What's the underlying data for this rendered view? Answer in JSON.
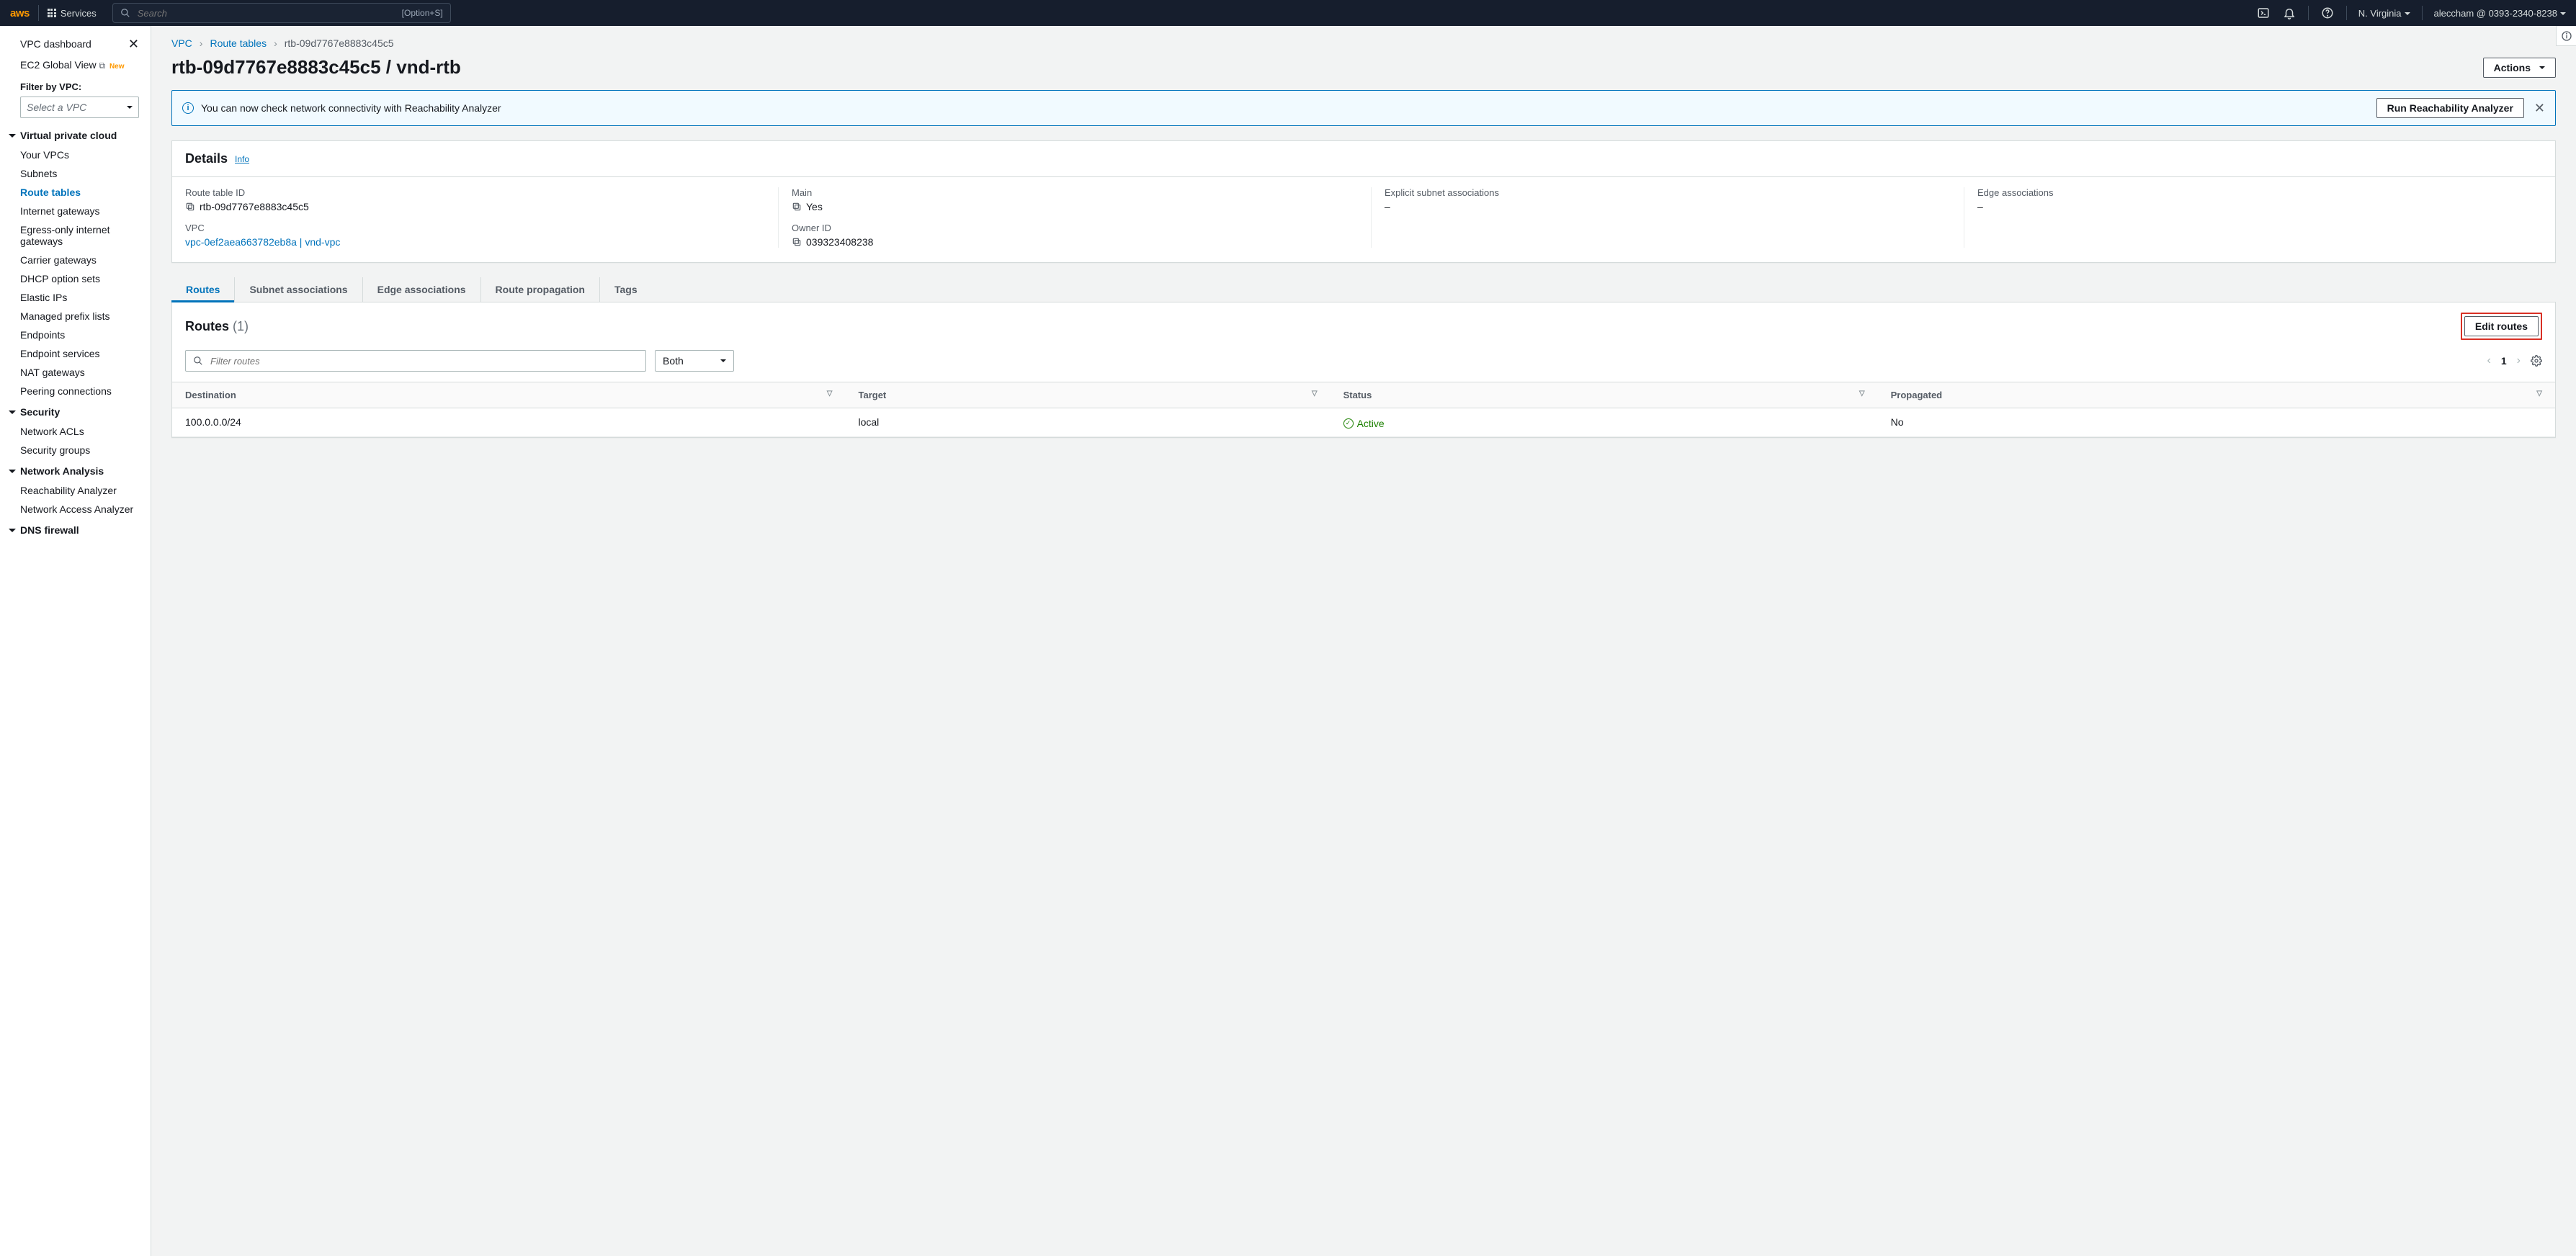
{
  "topnav": {
    "services_label": "Services",
    "search_placeholder": "Search",
    "search_hint": "[Option+S]",
    "region": "N. Virginia",
    "account": "aleccham @ 0393-2340-8238"
  },
  "sidebar": {
    "dashboard": "VPC dashboard",
    "ec2_global": "EC2 Global View",
    "new_badge": "New",
    "filter_label": "Filter by VPC:",
    "vpc_select_placeholder": "Select a VPC",
    "sections": {
      "vpc": {
        "title": "Virtual private cloud",
        "items": [
          "Your VPCs",
          "Subnets",
          "Route tables",
          "Internet gateways",
          "Egress-only internet gateways",
          "Carrier gateways",
          "DHCP option sets",
          "Elastic IPs",
          "Managed prefix lists",
          "Endpoints",
          "Endpoint services",
          "NAT gateways",
          "Peering connections"
        ]
      },
      "security": {
        "title": "Security",
        "items": [
          "Network ACLs",
          "Security groups"
        ]
      },
      "analysis": {
        "title": "Network Analysis",
        "items": [
          "Reachability Analyzer",
          "Network Access Analyzer"
        ]
      },
      "dns": {
        "title": "DNS firewall"
      }
    }
  },
  "breadcrumbs": {
    "vpc": "VPC",
    "route_tables": "Route tables",
    "current": "rtb-09d7767e8883c45c5"
  },
  "title": "rtb-09d7767e8883c45c5 / vnd-rtb",
  "actions_label": "Actions",
  "banner": {
    "text": "You can now check network connectivity with Reachability Analyzer",
    "button": "Run Reachability Analyzer"
  },
  "details": {
    "heading": "Details",
    "info_link": "Info",
    "fields": {
      "route_table_id": {
        "label": "Route table ID",
        "value": "rtb-09d7767e8883c45c5"
      },
      "main": {
        "label": "Main",
        "value": "Yes"
      },
      "explicit_assoc": {
        "label": "Explicit subnet associations",
        "value": "–"
      },
      "edge_assoc": {
        "label": "Edge associations",
        "value": "–"
      },
      "vpc": {
        "label": "VPC",
        "value": "vpc-0ef2aea663782eb8a | vnd-vpc"
      },
      "owner_id": {
        "label": "Owner ID",
        "value": "039323408238"
      }
    }
  },
  "tabs": [
    "Routes",
    "Subnet associations",
    "Edge associations",
    "Route propagation",
    "Tags"
  ],
  "routes_panel": {
    "heading": "Routes",
    "count": "(1)",
    "edit_button": "Edit routes",
    "filter_placeholder": "Filter routes",
    "scope_select": "Both",
    "page": "1",
    "columns": [
      "Destination",
      "Target",
      "Status",
      "Propagated"
    ],
    "rows": [
      {
        "destination": "100.0.0.0/24",
        "target": "local",
        "status": "Active",
        "propagated": "No"
      }
    ]
  }
}
